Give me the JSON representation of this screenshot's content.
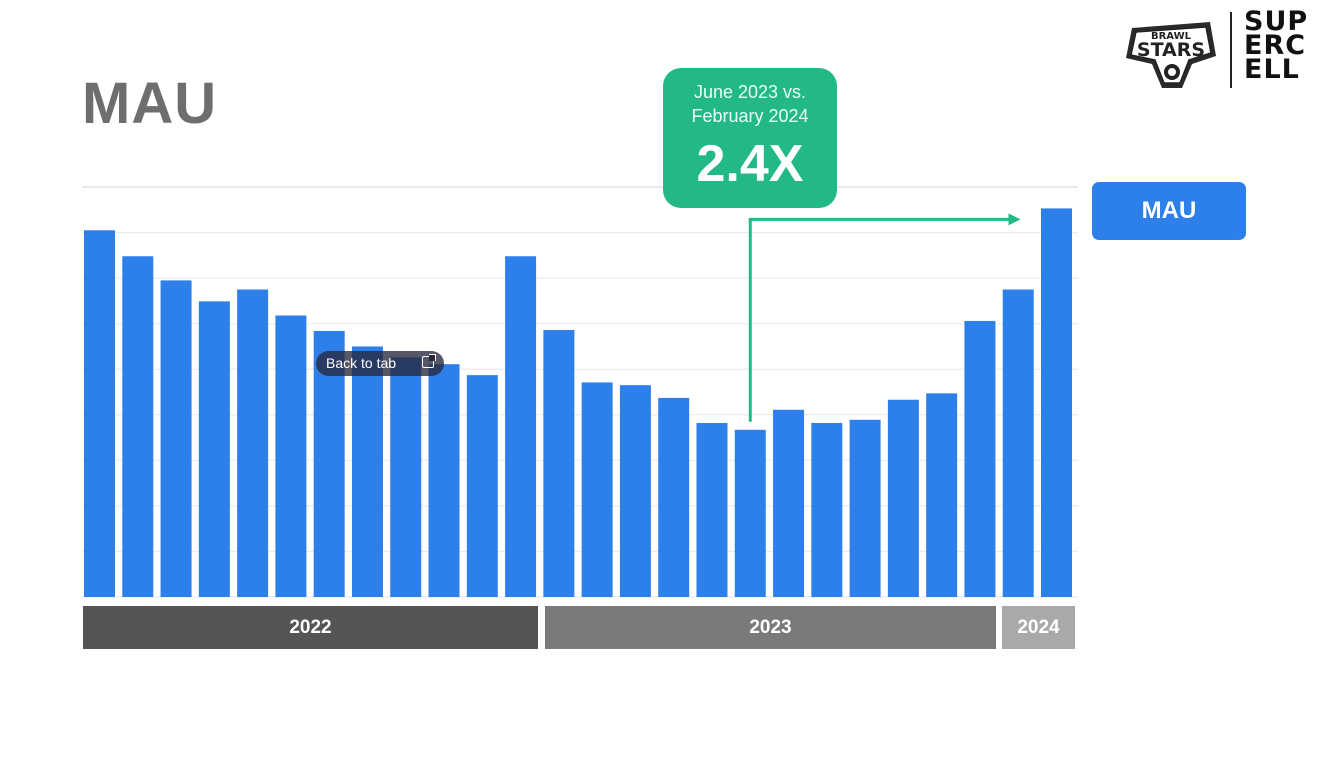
{
  "slide": {
    "title": "MAU",
    "brand": {
      "game_logo_text": [
        "BRAWL",
        "STARS"
      ],
      "company_logo_text": [
        "SUP",
        "ERC",
        "ELL"
      ]
    },
    "callout": {
      "line1": "June 2023 vs.",
      "line2": "February 2024",
      "value": "2.4X",
      "color": "#22b987"
    },
    "legend_label": "MAU",
    "overlay": {
      "back_to_tab": "Back to tab"
    }
  },
  "chart_data": {
    "type": "bar",
    "title": "MAU",
    "xlabel": "",
    "ylabel": "",
    "bar_color": "#2d7fea",
    "grid": true,
    "legend_placement": "right",
    "series": [
      {
        "name": "MAU",
        "values": [
          80.5,
          74.8,
          69.5,
          64.9,
          67.5,
          61.8,
          58.4,
          55,
          52.6,
          51.1,
          48.7,
          74.8,
          58.6,
          47.1,
          46.5,
          43.7,
          38.2,
          36.7,
          41.1,
          38.2,
          38.9,
          43.3,
          44.7,
          60.6,
          67.5,
          85.3
        ]
      }
    ],
    "categories": [
      "",
      "",
      "",
      "",
      "",
      "",
      "",
      "",
      "",
      "",
      "",
      "",
      "",
      "",
      "",
      "",
      "",
      "",
      "",
      "",
      "",
      "",
      "",
      "",
      "",
      ""
    ],
    "year_groups": [
      {
        "label": "2022",
        "count": 12
      },
      {
        "label": "2023",
        "count": 12
      },
      {
        "label": "2024",
        "count": 2
      }
    ],
    "ylim": [
      0,
      90
    ],
    "annotation": {
      "from_index": 17,
      "to_index": 25,
      "label": "2.4X"
    }
  }
}
